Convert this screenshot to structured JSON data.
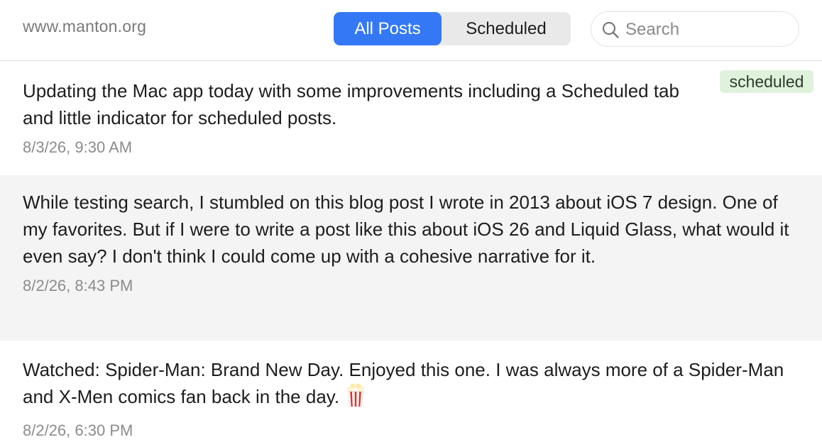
{
  "header": {
    "site": "www.manton.org",
    "tabs": [
      {
        "label": "All Posts",
        "active": true
      },
      {
        "label": "Scheduled",
        "active": false
      }
    ],
    "search_placeholder": "Search"
  },
  "colors": {
    "accent": "#3478f6",
    "badge_bg": "#dff3dc",
    "alt_row_bg": "#f3f4f3"
  },
  "posts": [
    {
      "text": "Updating the Mac app today with some improvements including a Scheduled tab and little indicator for scheduled posts.",
      "date": "8/3/26, 9:30 AM",
      "badge": "scheduled"
    },
    {
      "text": "While testing search, I stumbled on this blog post I wrote in 2013 about iOS 7 design. One of my favorites. But if I were to write a post like this about iOS 26 and Liquid Glass, what would it even say? I don't think I could come up with a cohesive narrative for it.",
      "date": "8/2/26, 8:43 PM"
    },
    {
      "text": "Watched: Spider-Man: Brand New Day. Enjoyed this one. I was always more of a Spider-Man and X-Men comics fan back in the day.",
      "date": "8/2/26, 6:30 PM",
      "emoji_icon": "popcorn-icon"
    }
  ]
}
